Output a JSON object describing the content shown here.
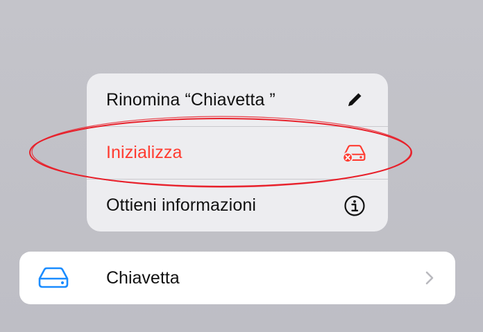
{
  "menu": {
    "items": [
      {
        "label": "Rinomina “Chiavetta ”",
        "icon": "pencil-icon",
        "destructive": false
      },
      {
        "label": "Inizializza",
        "icon": "erase-drive-icon",
        "destructive": true
      },
      {
        "label": "Ottieni informazioni",
        "icon": "info-icon",
        "destructive": false
      }
    ]
  },
  "drive": {
    "label": "Chiavetta",
    "icon": "external-drive-icon"
  },
  "colors": {
    "destructive": "#ff3b30",
    "accent": "#1a8cff",
    "highlight": "#e8202a",
    "background": "#c2c2c8"
  }
}
